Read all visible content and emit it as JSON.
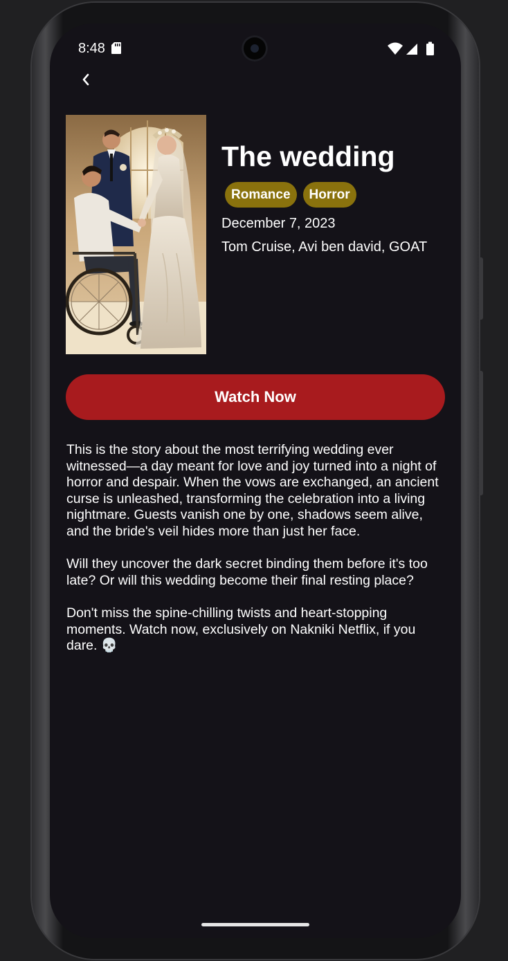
{
  "status_bar": {
    "time": "8:48",
    "icons": [
      "sd-card-icon",
      "wifi-icon",
      "cellular-signal-icon",
      "battery-icon"
    ]
  },
  "navigation": {
    "back_icon": "chevron-left-icon"
  },
  "movie": {
    "title": "The wedding",
    "genres": [
      "Romance",
      "Horror"
    ],
    "release_date": "December 7, 2023",
    "cast": "Tom Cruise, Avi ben david, GOAT",
    "poster_alt": "wedding-poster"
  },
  "actions": {
    "watch_label": "Watch Now"
  },
  "description": {
    "paragraph_1": "This is the story about the most terrifying wedding ever witnessed—a day meant for love and joy turned into a night of horror and despair. When the vows are exchanged, an ancient curse is unleashed, transforming the celebration into a living nightmare. Guests vanish one by one, shadows seem alive, and the bride's veil hides more than just her face.",
    "paragraph_2": "Will they uncover the dark secret binding them before it's too late? Or will this wedding become their final resting place?",
    "paragraph_3": "Don't miss the spine-chilling twists and heart-stopping moments. Watch now, exclusively on Nakniki Netflix, if you dare. 💀"
  },
  "colors": {
    "background": "#141218",
    "accent": "#a81b1e",
    "genre_chip": "#8a720d",
    "text": "#ffffff"
  }
}
